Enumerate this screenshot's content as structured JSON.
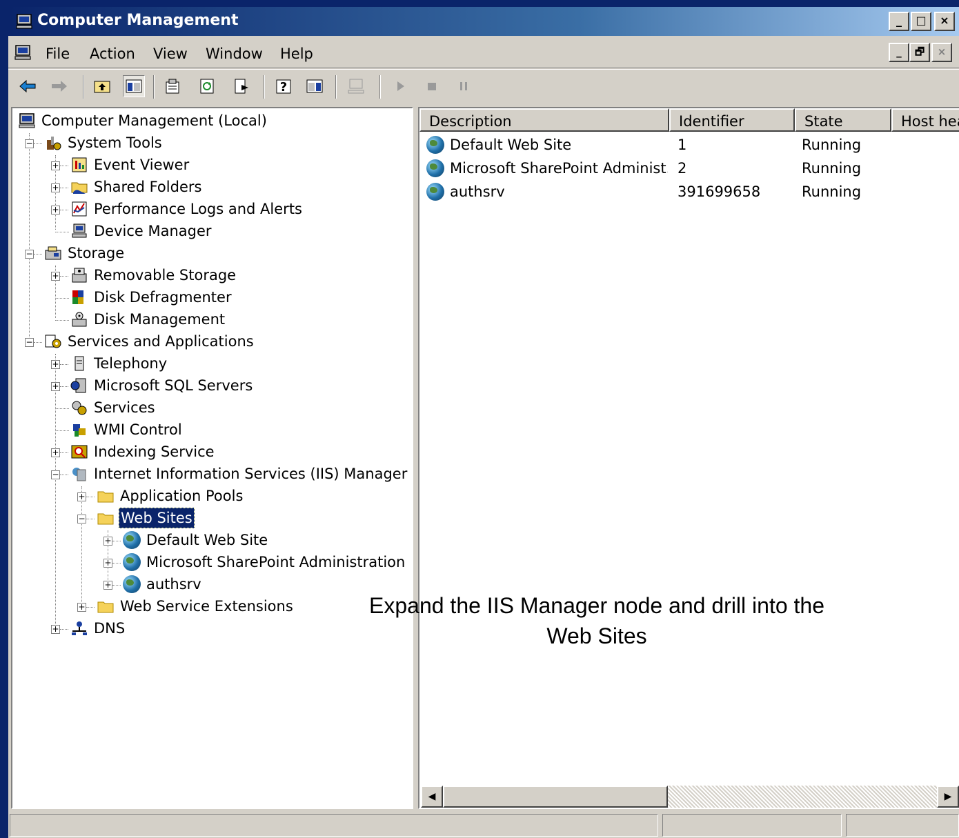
{
  "window": {
    "title": "Computer Management",
    "controls": {
      "minimize": "_",
      "restore": "□",
      "close": "×"
    }
  },
  "menubar": {
    "items": [
      "File",
      "Action",
      "View",
      "Window",
      "Help"
    ],
    "mdi_controls": {
      "minimize": "_",
      "restore": "🗗",
      "close": "×"
    }
  },
  "toolbar": {
    "icons": [
      "back-arrow",
      "forward-arrow",
      "up-folder",
      "show-hide-tree",
      "properties",
      "refresh",
      "export-list",
      "help",
      "show-hide-action-pane",
      "connect-computer",
      "start-service",
      "stop-service",
      "pause-service"
    ]
  },
  "tree": {
    "root": "Computer Management (Local)",
    "system_tools": "System Tools",
    "event_viewer": "Event Viewer",
    "shared_folders": "Shared Folders",
    "perf_logs": "Performance Logs and Alerts",
    "device_manager": "Device Manager",
    "storage": "Storage",
    "removable_storage": "Removable Storage",
    "disk_defrag": "Disk Defragmenter",
    "disk_management": "Disk Management",
    "services_apps": "Services and Applications",
    "telephony": "Telephony",
    "sql_servers": "Microsoft SQL Servers",
    "services": "Services",
    "wmi": "WMI Control",
    "indexing": "Indexing Service",
    "iis": "Internet Information Services (IIS) Manager",
    "app_pools": "Application Pools",
    "web_sites": "Web Sites",
    "site_default": "Default Web Site",
    "site_sharepoint": "Microsoft SharePoint Administration",
    "site_authsrv": "authsrv",
    "web_service_ext": "Web Service Extensions",
    "dns": "DNS"
  },
  "list": {
    "columns": [
      "Description",
      "Identifier",
      "State",
      "Host hea"
    ],
    "rows": [
      {
        "description": "Default Web Site",
        "identifier": "1",
        "state": "Running"
      },
      {
        "description": "Microsoft SharePoint Administ...",
        "identifier": "2",
        "state": "Running"
      },
      {
        "description": "authsrv",
        "identifier": "391699658",
        "state": "Running"
      }
    ]
  },
  "scrollbar": {
    "left_arrow": "◀",
    "right_arrow": "▶"
  },
  "caption": {
    "line1": "Expand the IIS Manager node and drill into the",
    "line2": "Web Sites"
  },
  "colors": {
    "titlebar_start": "#0a246a",
    "titlebar_end": "#a6caf0",
    "selection": "#0a246a",
    "chrome": "#d4d0c8"
  }
}
